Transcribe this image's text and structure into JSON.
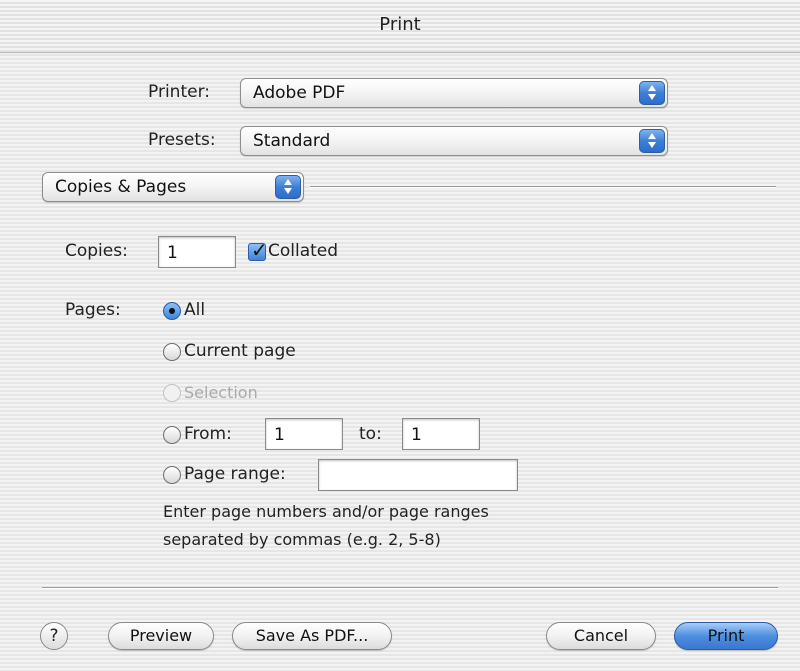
{
  "window": {
    "title": "Print"
  },
  "printer": {
    "label": "Printer:",
    "value": "Adobe PDF"
  },
  "presets": {
    "label": "Presets:",
    "value": "Standard"
  },
  "panel": {
    "value": "Copies & Pages"
  },
  "copies": {
    "label": "Copies:",
    "value": "1",
    "collated_label": "Collated",
    "collated_checked": true
  },
  "pages": {
    "label": "Pages:",
    "options": {
      "all": "All",
      "current": "Current page",
      "selection": "Selection",
      "from": "From:",
      "to": "to:",
      "range": "Page range:"
    },
    "from_value": "1",
    "to_value": "1",
    "range_value": "",
    "selected": "all",
    "hint_line1": "Enter page numbers and/or page ranges",
    "hint_line2": "separated by commas (e.g. 2, 5-8)"
  },
  "buttons": {
    "help": "?",
    "preview": "Preview",
    "save_pdf": "Save As PDF...",
    "cancel": "Cancel",
    "print": "Print"
  }
}
